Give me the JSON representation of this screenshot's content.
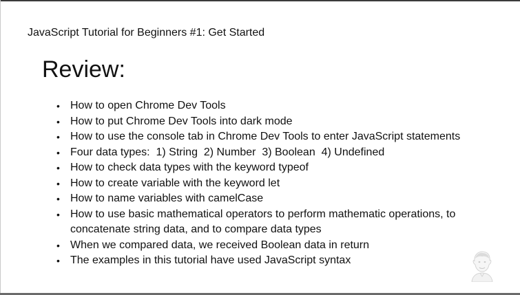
{
  "header": {
    "title": "JavaScript Tutorial for Beginners #1: Get Started"
  },
  "slide": {
    "heading": "Review:",
    "bullet_symbol": "•",
    "bullets": [
      "How to open Chrome Dev Tools",
      "How to put Chrome Dev Tools into dark mode",
      "How to use the console tab in Chrome Dev Tools to enter JavaScript statements",
      "Four data types:  1) String  2) Number  3) Boolean  4) Undefined",
      "How to check data types with the keyword typeof",
      "How to create variable with the keyword let",
      "How to name variables with camelCase",
      "How to use basic mathematical operators to perform mathematic operations, to concatenate string data, and to compare data types",
      "When we compared data, we received Boolean data in return",
      "The examples in this tutorial have used JavaScript syntax"
    ]
  },
  "watermark": {
    "icon": "presenter-avatar-icon"
  }
}
